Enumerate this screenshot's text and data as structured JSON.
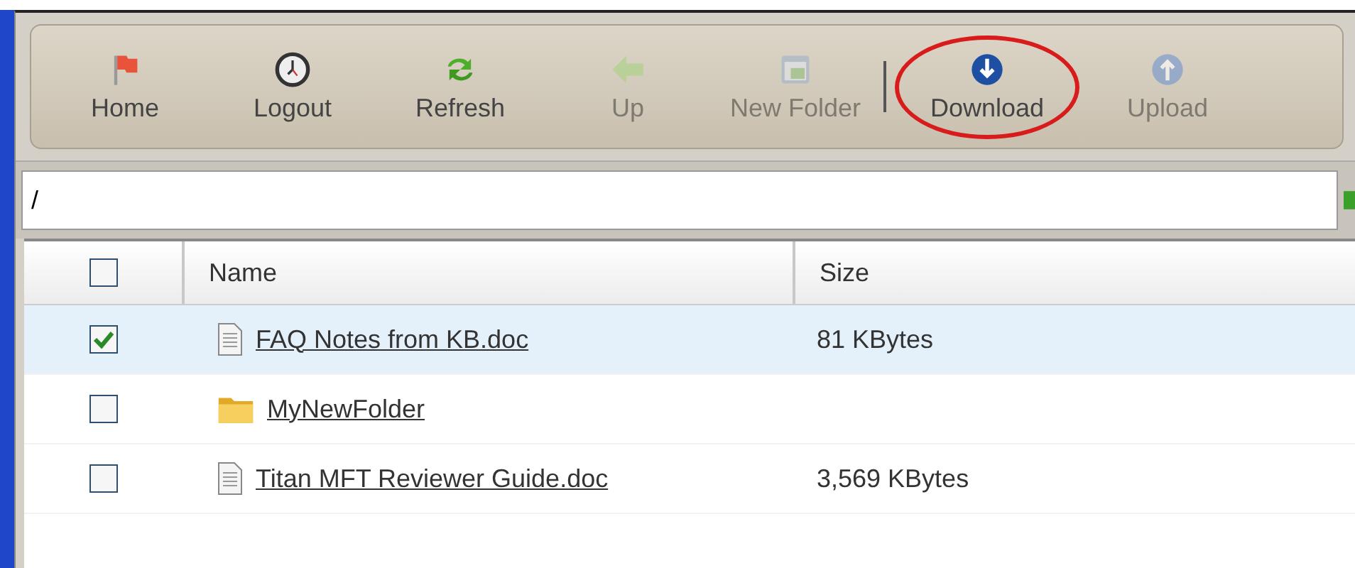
{
  "toolbar": [
    {
      "label": "Home",
      "kind": "flag",
      "disabled": false,
      "highlighted": false
    },
    {
      "label": "Logout",
      "kind": "clock",
      "disabled": false,
      "highlighted": false
    },
    {
      "label": "Refresh",
      "kind": "refresh",
      "disabled": false,
      "highlighted": false
    },
    {
      "label": "Up",
      "kind": "up",
      "disabled": true,
      "highlighted": false
    },
    {
      "label": "New Folder",
      "kind": "newfolder",
      "disabled": true,
      "highlighted": false
    },
    {
      "label": "Download",
      "kind": "download",
      "disabled": false,
      "highlighted": true
    },
    {
      "label": "Upload",
      "kind": "upload",
      "disabled": true,
      "highlighted": false
    }
  ],
  "path": {
    "value": "/"
  },
  "table": {
    "select_all": {
      "checked": false
    },
    "columns": [
      "Name",
      "Size"
    ],
    "rows": [
      {
        "kind": "doc",
        "name": "FAQ Notes from KB.doc",
        "size": "81 KBytes",
        "checked": true,
        "selected": true
      },
      {
        "kind": "folder",
        "name": "MyNewFolder",
        "checked": false,
        "selected": false
      },
      {
        "kind": "doc",
        "name": "Titan MFT Reviewer Guide.doc",
        "size": "3,569 KBytes",
        "checked": false,
        "selected": false
      }
    ]
  }
}
